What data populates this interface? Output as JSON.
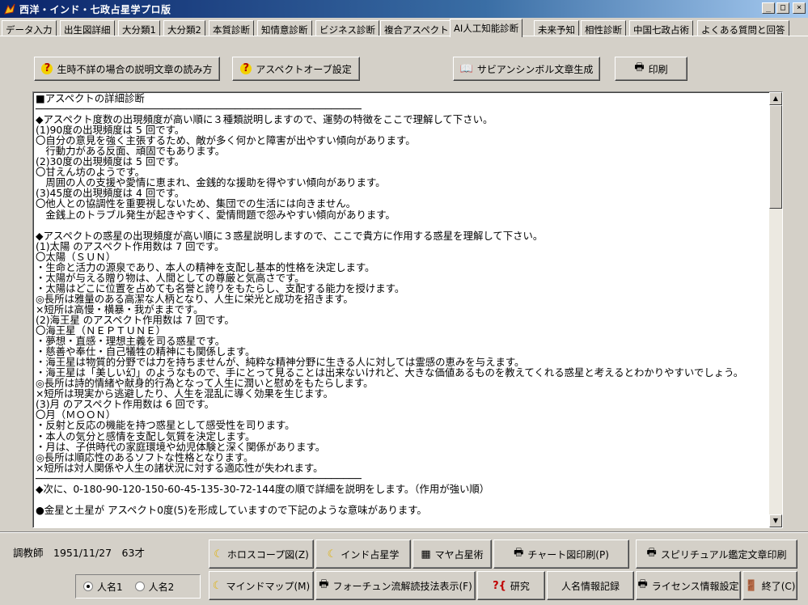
{
  "window": {
    "title": "西洋・インド・七政占星学プロ版",
    "controls": {
      "minimize": "_",
      "maximize": "□",
      "close": "×"
    }
  },
  "tabs": [
    {
      "label": "データ入力",
      "active": false
    },
    {
      "label": "出生図詳細",
      "active": false
    },
    {
      "label": "大分類1",
      "active": false
    },
    {
      "label": "大分類2",
      "active": false
    },
    {
      "label": "本質診断",
      "active": false
    },
    {
      "label": "知情意診断",
      "active": false
    },
    {
      "label": "ビジネス診断",
      "active": false
    },
    {
      "label": "複合アスペクト",
      "active": false
    },
    {
      "label": "AI人工知能診断",
      "active": true
    },
    {
      "label": "未来予知",
      "active": false
    },
    {
      "label": "相性診断",
      "active": false
    },
    {
      "label": "中国七政占術",
      "active": false
    },
    {
      "label": "よくある質問と回答",
      "active": false
    }
  ],
  "toolbar": {
    "unknown_time_button": "生時不詳の場合の説明文章の読み方",
    "aspect_orb_button": "アスペクトオーブ設定",
    "sabian_button": "サビアンシンボル文章生成",
    "print_button": "印刷"
  },
  "icons": {
    "question": "?",
    "moon": "☾",
    "print": "🖶",
    "book": "📖",
    "research": "?{",
    "exit": "🚪"
  },
  "report": {
    "text": "■アスペクトの詳細診断\n──────────────────────────────────────────────────────\n◆アスペクト度数の出現頻度が高い順に３種類説明しますので、運勢の特徴をここで理解して下さい。\n(1)90度の出現頻度は 5 回です。\n〇自分の意見を強く主張するため、敵が多く何かと障害が出やすい傾向があります。\n　行動力がある反面、頑固でもあります。\n(2)30度の出現頻度は 5 回です。\n〇甘えん坊のようです。\n　周囲の人の支援や愛情に恵まれ、金銭的な援助を得やすい傾向があります。\n(3)45度の出現頻度は 4 回です。\n〇他人との協調性を重要視しないため、集団での生活には向きません。\n　金銭上のトラブル発生が起きやすく、愛情問題で怨みやすい傾向があります。\n\n◆アスペクトの惑星の出現頻度が高い順に３惑星説明しますので、ここで貴方に作用する惑星を理解して下さい。\n(1)太陽 のアスペクト作用数は 7 回です。\n〇太陽（ＳＵＮ）\n・生命と活力の源泉であり、本人の精神を支配し基本的性格を決定します。\n・太陽が与える贈り物は、人間としての尊厳と気高さです。\n・太陽はどこに位置を占めても名誉と誇りをもたらし、支配する能力を授けます。\n◎長所は雅量のある高潔な人柄となり、人生に栄光と成功を招きます。\n×短所は高慢・横暴・我がままです。\n(2)海王星 のアスペクト作用数は 7 回です。\n〇海王星（ＮＥＰＴＵＮＥ）\n・夢想・直感・理想主義を司る惑星です。\n・慈善や奉仕・自己犠牲の精神にも関係します。\n・海王星は物質的分野では力を持ちませんが、純粋な精神分野に生きる人に対しては霊感の恵みを与えます。\n・海王星は「美しい幻」のようなもので、手にとって見ることは出来ないけれど、大きな価値あるものを教えてくれる惑星と考えるとわかりやすいでしょう。\n◎長所は詩的情緒や献身的行為となって人生に潤いと慰めをもたらします。\n×短所は現実から逃避したり、人生を混乱に導く効果を生じます。\n(3)月 のアスペクト作用数は 6 回です。\n〇月（ＭＯＯＮ）\n・反射と反応の機能を持つ惑星として感受性を司ります。\n・本人の気分と感情を支配し気質を決定します。\n・月は、子供時代の家庭環境や幼児体験と深く関係があります。\n◎長所は順応性のあるソフトな性格となります。\n×短所は対人関係や人生の諸状況に対する適応性が失われます。\n──────────────────────────────────────────────────────\n◆次に、0-180-90-120-150-60-45-135-30-72-144度の順で詳細を説明をします。（作用が強い順）\n\n●金星と土星が アスペクト0度(5)を形成していますので下記のような意味があります。"
  },
  "footer": {
    "user_info": "調教師　1951/11/27　63才",
    "radio_person1": "人名1",
    "radio_person2": "人名2",
    "selected_person": "人名1",
    "buttons": {
      "horoscope": "ホロスコープ図(Z)",
      "indian": "インド占星学",
      "maya": "マヤ占星術",
      "chart_print": "チャート図印刷(P)",
      "spiritual_print": "スピリチュアル鑑定文章印刷",
      "mindmap": "マインドマップ(M)",
      "fortune": "フォーチュン流解読技法表示(F)",
      "research": "研究",
      "person_record": "人名情報記録",
      "license": "ライセンス情報設定",
      "exit": "終了(C)"
    }
  }
}
